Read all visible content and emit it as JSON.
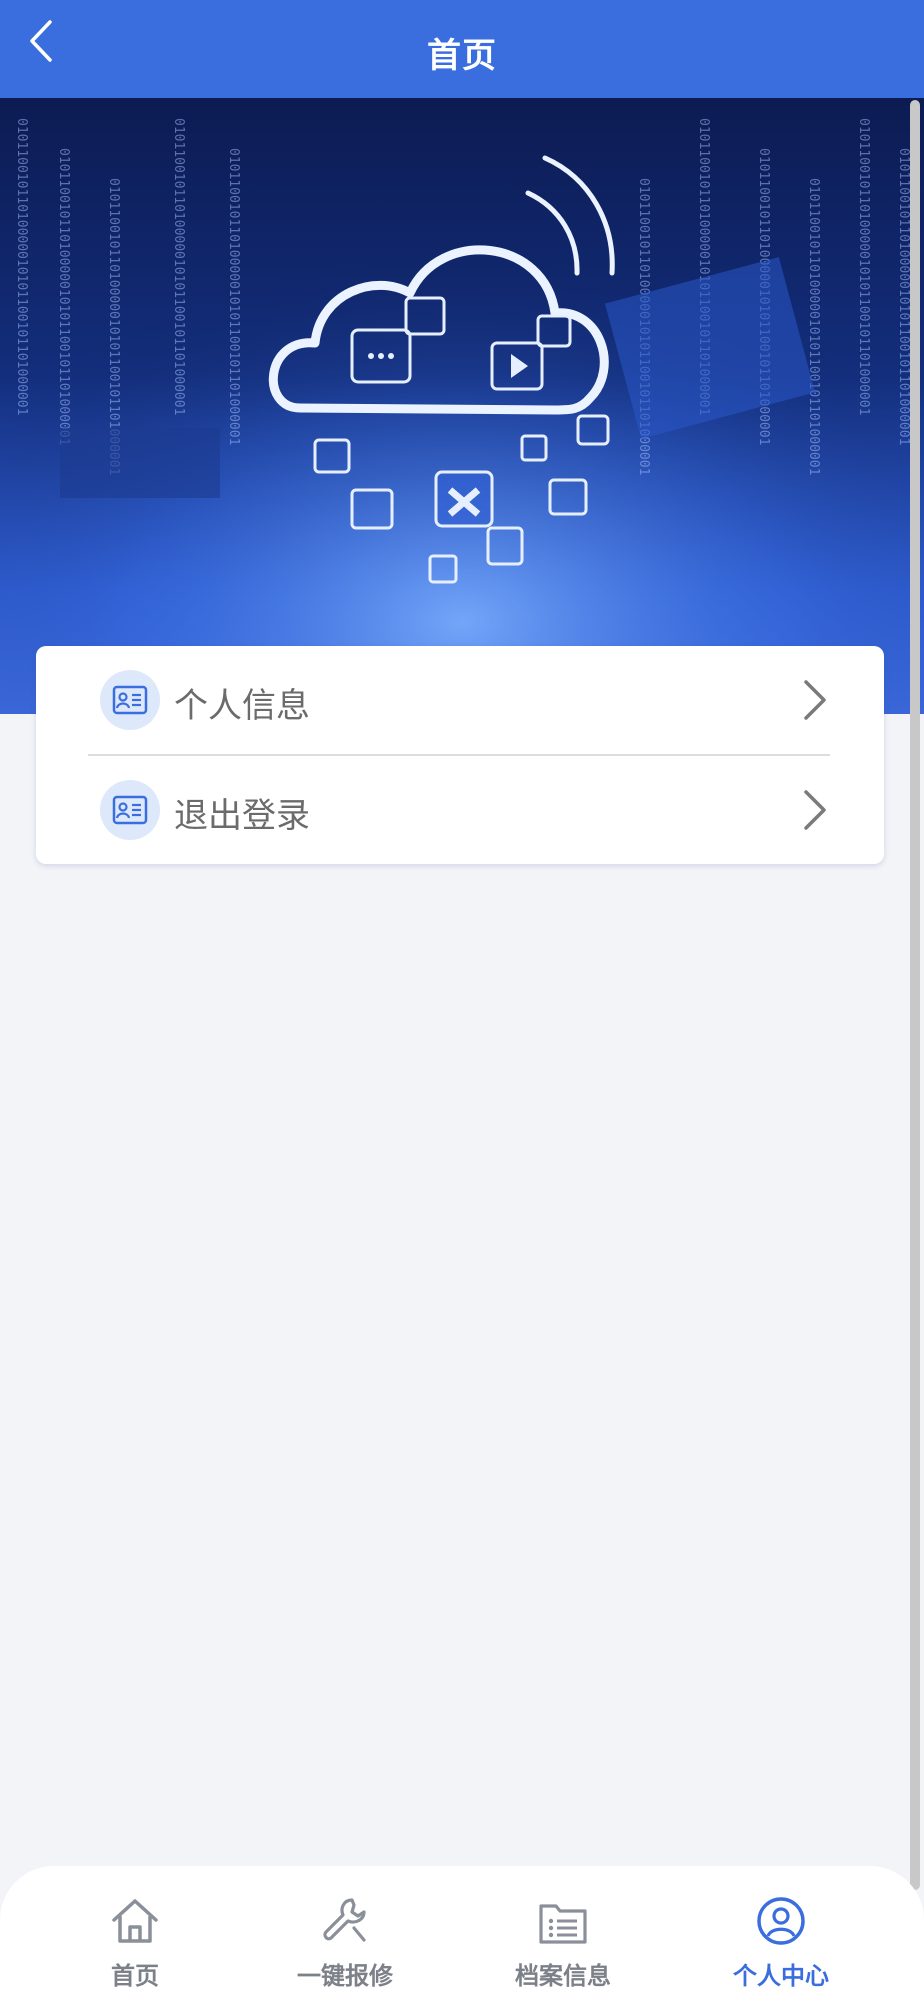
{
  "header": {
    "title": "首页",
    "back_icon": "chevron-left-icon"
  },
  "banner": {
    "image": "cloud-technology-banner",
    "binary_text": "0101100101101000001"
  },
  "menu": [
    {
      "label": "个人信息",
      "icon": "id-card-icon"
    },
    {
      "label": "退出登录",
      "icon": "id-card-icon"
    }
  ],
  "tabbar": {
    "items": [
      {
        "label": "首页",
        "icon": "home-icon",
        "active": false
      },
      {
        "label": "一键报修",
        "icon": "wrench-icon",
        "active": false
      },
      {
        "label": "档案信息",
        "icon": "folder-list-icon",
        "active": false
      },
      {
        "label": "个人中心",
        "icon": "user-circle-icon",
        "active": true
      }
    ]
  },
  "colors": {
    "primary": "#3a6ede",
    "background": "#f3f4f8",
    "tab_inactive": "#7c8089"
  }
}
